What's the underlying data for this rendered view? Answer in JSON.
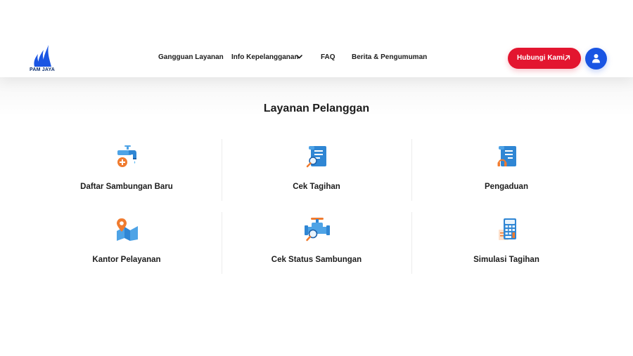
{
  "brand": {
    "logo_text": "PAM JAYA"
  },
  "nav": {
    "items": [
      {
        "label": "Gangguan Layanan"
      },
      {
        "label": "Info Kepelangganan"
      },
      {
        "label": "FAQ"
      },
      {
        "label": "Berita & Pengumuman"
      }
    ]
  },
  "header": {
    "cta_label": "Hubungi Kami"
  },
  "main": {
    "title": "Layanan Pelanggan",
    "services": [
      {
        "label": "Daftar Sambungan Baru",
        "icon": "faucet-add-icon"
      },
      {
        "label": "Cek Tagihan",
        "icon": "bill-check-icon"
      },
      {
        "label": "Pengaduan",
        "icon": "complaint-headset-icon"
      },
      {
        "label": "Kantor Pelayanan",
        "icon": "office-location-icon"
      },
      {
        "label": "Cek Status Sambungan",
        "icon": "pipe-valve-search-icon"
      },
      {
        "label": "Simulasi Tagihan",
        "icon": "calculator-icon"
      }
    ]
  },
  "colors": {
    "primary_blue": "#1a55e3",
    "accent_red": "#e3152f",
    "icon_light_blue": "#4ea3e6",
    "icon_orange": "#f07b2f",
    "text_dark": "#1c1c1c"
  }
}
